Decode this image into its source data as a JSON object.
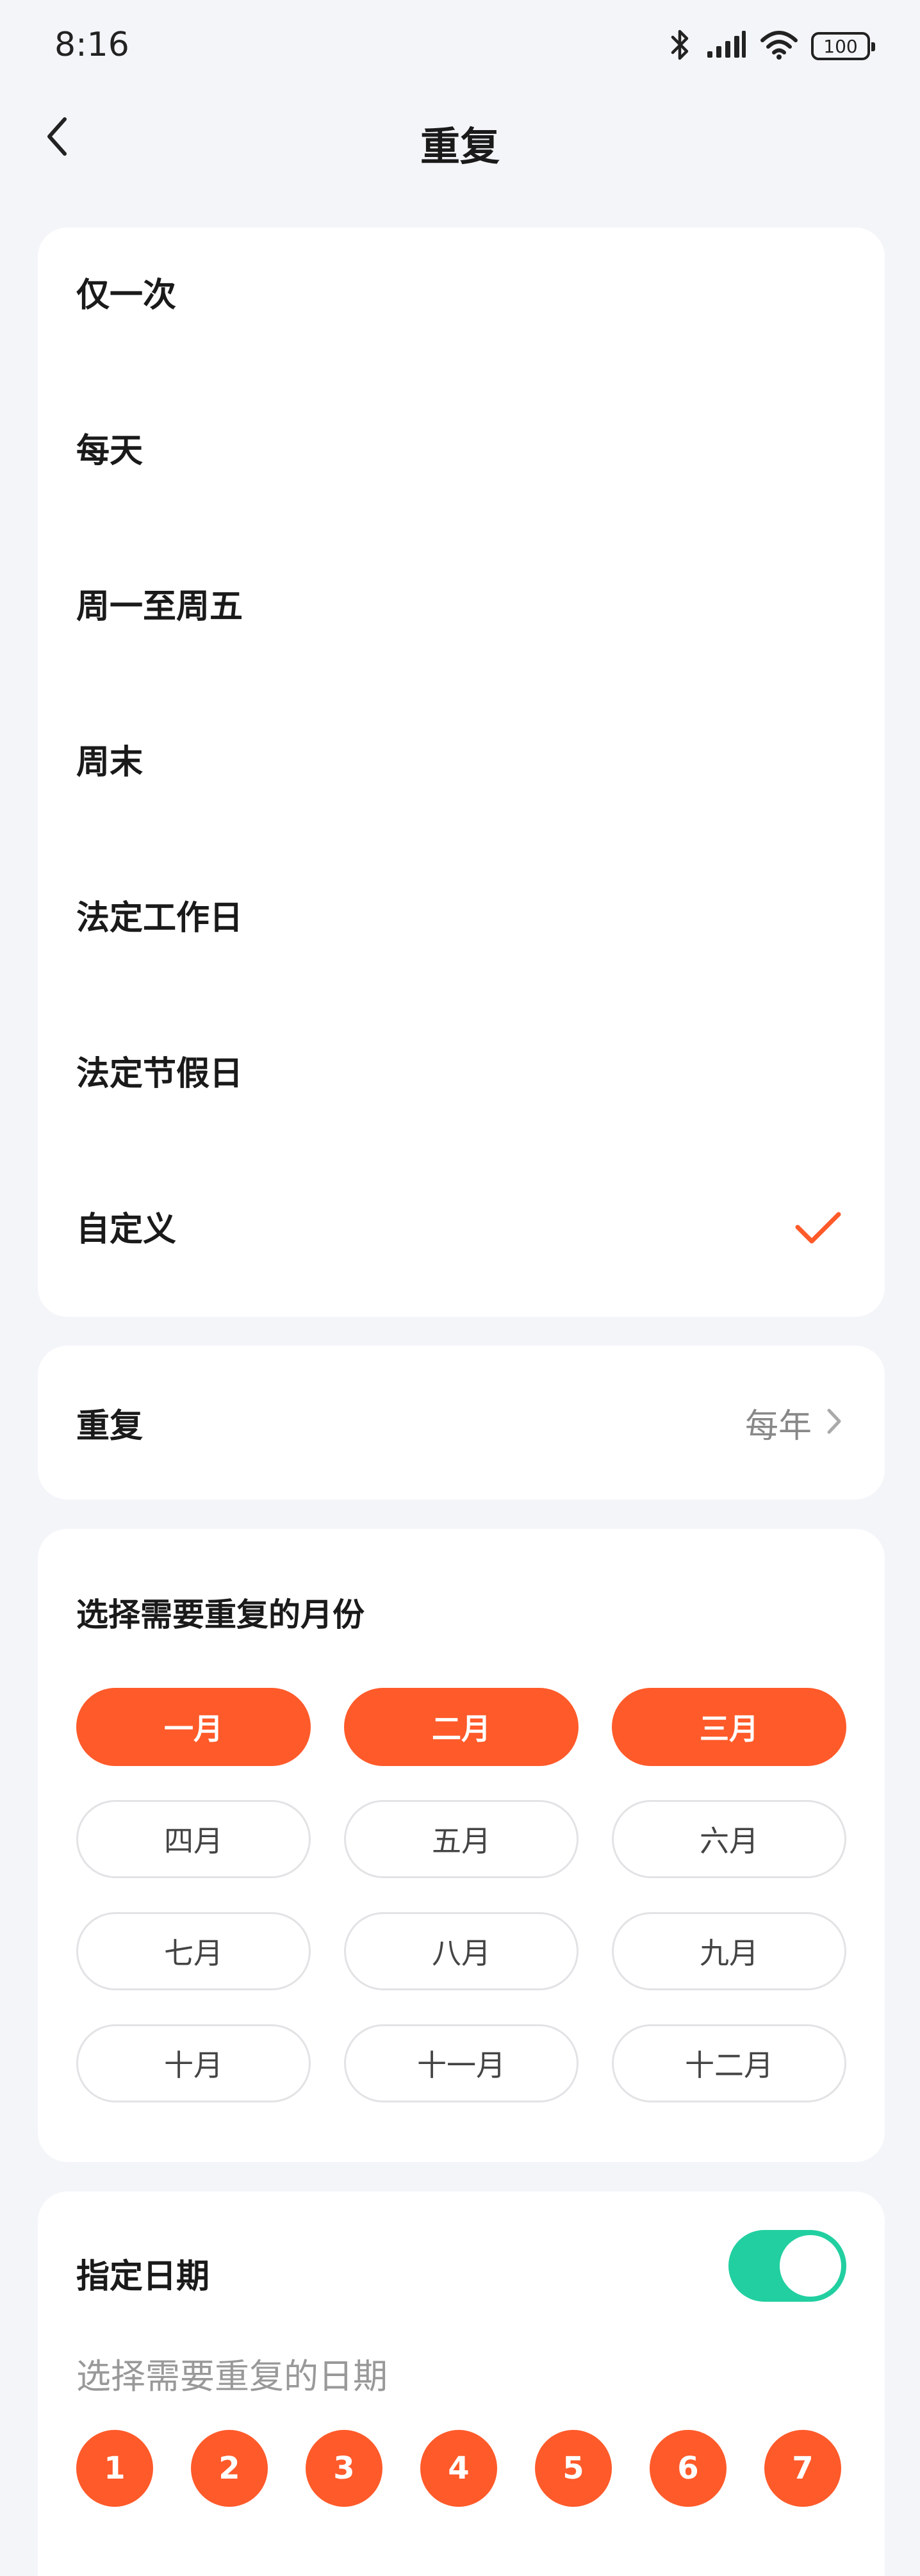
{
  "status_bar": {
    "time": "8:16",
    "battery": "100",
    "icons": [
      "bluetooth-icon",
      "signal-icon",
      "wifi-icon",
      "battery-icon"
    ]
  },
  "header": {
    "title": "重复",
    "back_icon": "chevron-left-icon"
  },
  "options": {
    "items": [
      {
        "label": "仅一次",
        "selected": false
      },
      {
        "label": "每天",
        "selected": false
      },
      {
        "label": "周一至周五",
        "selected": false
      },
      {
        "label": "周末",
        "selected": false
      },
      {
        "label": "法定工作日",
        "selected": false
      },
      {
        "label": "法定节假日",
        "selected": false
      },
      {
        "label": "自定义",
        "selected": true
      }
    ],
    "check_icon": "checkmark-icon"
  },
  "repeat": {
    "label": "重复",
    "value": "每年",
    "chevron_icon": "chevron-right-icon"
  },
  "months": {
    "title": "选择需要重复的月份",
    "items": [
      {
        "label": "一月",
        "selected": true
      },
      {
        "label": "二月",
        "selected": true
      },
      {
        "label": "三月",
        "selected": true
      },
      {
        "label": "四月",
        "selected": false
      },
      {
        "label": "五月",
        "selected": false
      },
      {
        "label": "六月",
        "selected": false
      },
      {
        "label": "七月",
        "selected": false
      },
      {
        "label": "八月",
        "selected": false
      },
      {
        "label": "九月",
        "selected": false
      },
      {
        "label": "十月",
        "selected": false
      },
      {
        "label": "十一月",
        "selected": false
      },
      {
        "label": "十二月",
        "selected": false
      }
    ]
  },
  "dates": {
    "title": "指定日期",
    "toggle_on": true,
    "subtitle": "选择需要重复的日期",
    "days": [
      "1",
      "2",
      "3",
      "4",
      "5",
      "6",
      "7"
    ]
  },
  "colors": {
    "accent": "#ff5a2a",
    "toggle_on": "#22cfa0",
    "background": "#f4f5f9"
  }
}
